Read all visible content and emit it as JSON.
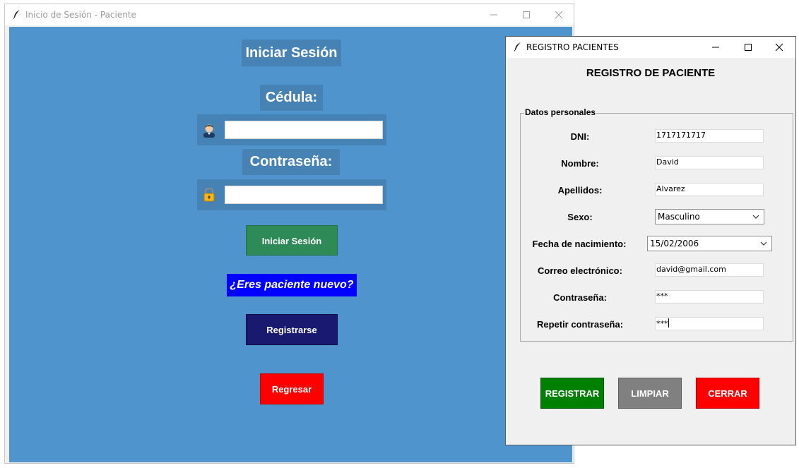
{
  "login_window": {
    "title": "Inicio de Sesión - Paciente",
    "heading": "Iniciar Sesión",
    "cedula_label": "Cédula:",
    "cedula_value": "",
    "password_label": "Contraseña:",
    "password_value": "",
    "login_button": "Iniciar Sesión",
    "new_patient_text": "¿Eres paciente nuevo?",
    "register_button": "Registrarse",
    "back_button": "Regresar"
  },
  "register_window": {
    "title": "REGISTRO PACIENTES",
    "heading": "REGISTRO DE PACIENTE",
    "group_label": "Datos personales",
    "fields": {
      "dni": {
        "label": "DNI:",
        "value": "1717171717"
      },
      "nombre": {
        "label": "Nombre:",
        "value": "David"
      },
      "apellidos": {
        "label": "Apellidos:",
        "value": "Alvarez"
      },
      "sexo": {
        "label": "Sexo:",
        "value": "Masculino"
      },
      "fecha": {
        "label": "Fecha de nacimiento:",
        "value": "15/02/2006"
      },
      "correo": {
        "label": "Correo electrónico:",
        "value": "david@gmail.com"
      },
      "contrasena": {
        "label": "Contraseña:",
        "value": "***"
      },
      "repetir": {
        "label": "Repetir contraseña:",
        "value": "***"
      }
    },
    "buttons": {
      "registrar": "REGISTRAR",
      "limpiar": "LIMPIAR",
      "cerrar": "CERRAR"
    }
  },
  "colors": {
    "login_background": "#4f94cd",
    "panel": "#4682b4",
    "login_button": "#2e8b57",
    "new_patient_bg": "#0000ff",
    "register_button": "#191970",
    "back_button": "#ff0000",
    "registrar": "#008000",
    "limpiar": "#808080",
    "cerrar": "#ff0000"
  },
  "icons": [
    "feather-icon",
    "user-icon",
    "lock-icon",
    "minimize-icon",
    "maximize-icon",
    "close-icon",
    "chevron-down-icon"
  ]
}
